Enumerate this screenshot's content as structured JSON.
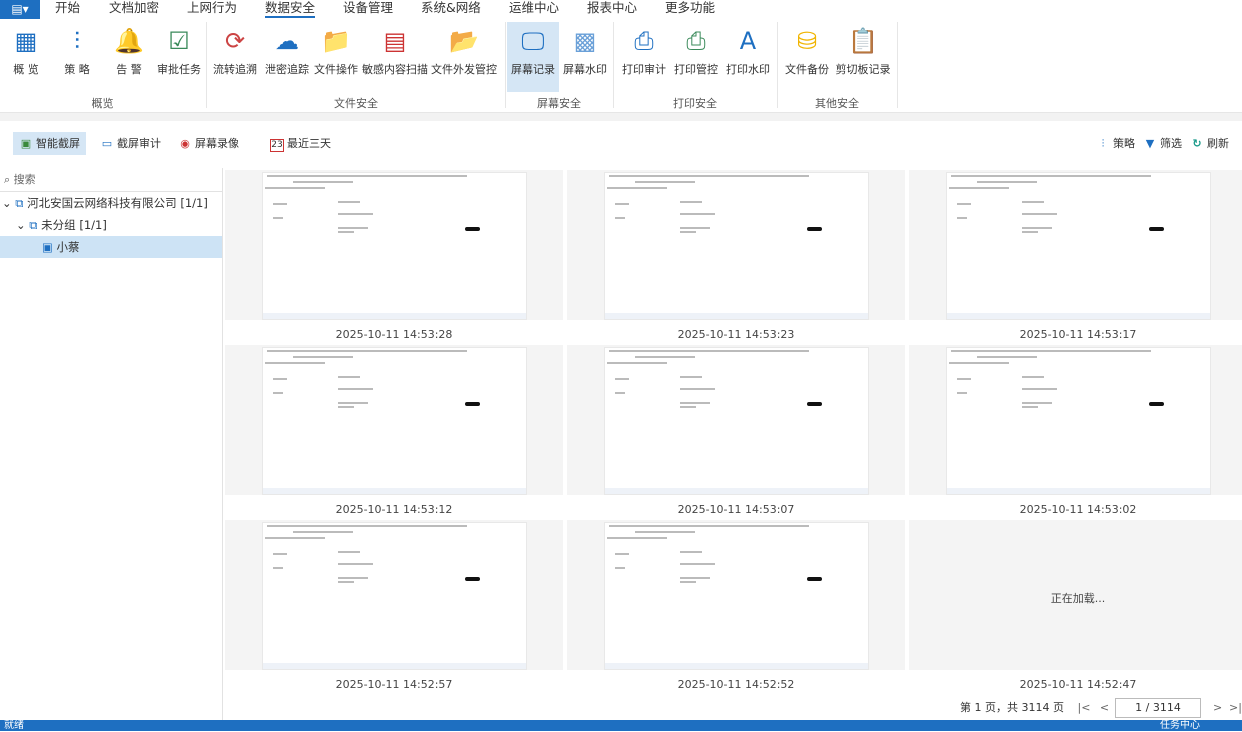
{
  "menu": {
    "app_icon": "app-menu-icon",
    "tabs": [
      "开始",
      "文档加密",
      "上网行为",
      "数据安全",
      "设备管理",
      "系统&网络",
      "运维中心",
      "报表中心",
      "更多功能"
    ],
    "active": "数据安全"
  },
  "ribbon": {
    "buttons": [
      "概 览",
      "策 略",
      "告 警",
      "审批任务",
      "流转追溯",
      "泄密追踪",
      "文件操作",
      "敏感内容扫描",
      "文件外发管控",
      "屏幕记录",
      "屏幕水印",
      "打印审计",
      "打印管控",
      "打印水印",
      "文件备份",
      "剪切板记录"
    ],
    "groups": [
      "概览",
      "文件安全",
      "屏幕安全",
      "打印安全",
      "其他安全"
    ],
    "active": "屏幕记录"
  },
  "toolbar": {
    "smart": "智能截屏",
    "audit": "截屏审计",
    "record": "屏幕录像",
    "range": "最近三天",
    "range_day": "23",
    "policy": "策略",
    "filter": "筛选",
    "refresh": "刷新"
  },
  "tree": {
    "search_placeholder": "搜索",
    "company": "河北安国云网络科技有限公司",
    "company_count": "[1/1]",
    "group": "未分组",
    "group_count": "[1/1]",
    "device": "小蔡"
  },
  "thumbnails": [
    {
      "time": "2025-10-11 14:53:28"
    },
    {
      "time": "2025-10-11 14:53:23"
    },
    {
      "time": "2025-10-11 14:53:17"
    },
    {
      "time": "2025-10-11 14:53:12"
    },
    {
      "time": "2025-10-11 14:53:07"
    },
    {
      "time": "2025-10-11 14:53:02"
    },
    {
      "time": "2025-10-11 14:52:57"
    },
    {
      "time": "2025-10-11 14:52:52"
    },
    {
      "time": "2025-10-11 14:52:47",
      "loading": "正在加载..."
    }
  ],
  "pager": {
    "text": "第 1 页，共 3114 页",
    "input": "1 / 3114"
  },
  "status": {
    "left": "就绪",
    "right": "任务中心"
  },
  "colors": {
    "accent": "#1e6fc1",
    "selected": "#d5e6f5"
  }
}
